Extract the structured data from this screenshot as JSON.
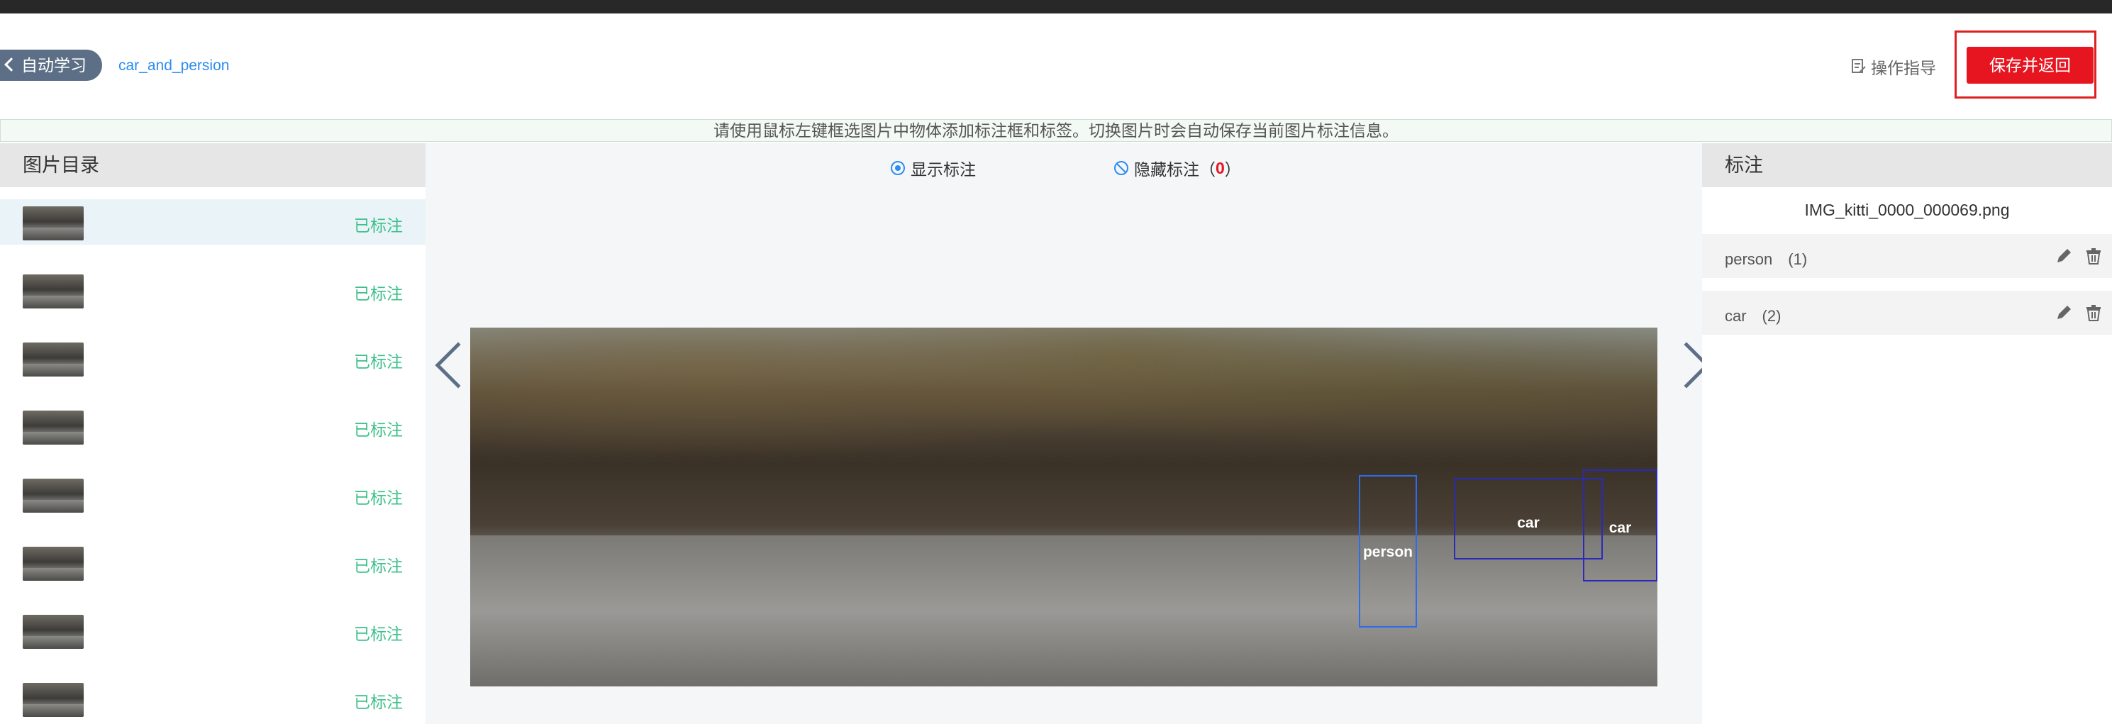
{
  "header": {
    "back_label": "自动学习",
    "dataset_name": "car_and_persion",
    "guide_label": "操作指导",
    "save_label": "保存并返回"
  },
  "tip": "请使用鼠标左键框选图片中物体添加标注框和标签。切换图片时会自动保存当前图片标注信息。",
  "left_panel": {
    "title": "图片目录",
    "items": [
      {
        "status": "已标注"
      },
      {
        "status": "已标注"
      },
      {
        "status": "已标注"
      },
      {
        "status": "已标注"
      },
      {
        "status": "已标注"
      },
      {
        "status": "已标注"
      },
      {
        "status": "已标注"
      },
      {
        "status": "已标注"
      }
    ]
  },
  "center": {
    "show_label": "显示标注",
    "hide_label": "隐藏标注（",
    "hide_count": "0",
    "hide_suffix": "）",
    "boxes": [
      {
        "label": "person",
        "color": "#2d6cf0"
      },
      {
        "label": "car",
        "color": "#2a2ab8"
      },
      {
        "label": "car",
        "color": "#2a2ab8"
      }
    ]
  },
  "right_panel": {
    "title": "标注",
    "image_name": "IMG_kitti_0000_000069.png",
    "annotations": [
      {
        "label": "person　(1)"
      },
      {
        "label": "car　(2)"
      }
    ]
  },
  "colors": {
    "accent": "#2d8cf0",
    "save": "#e6151f",
    "status_done": "#3cc08a"
  }
}
